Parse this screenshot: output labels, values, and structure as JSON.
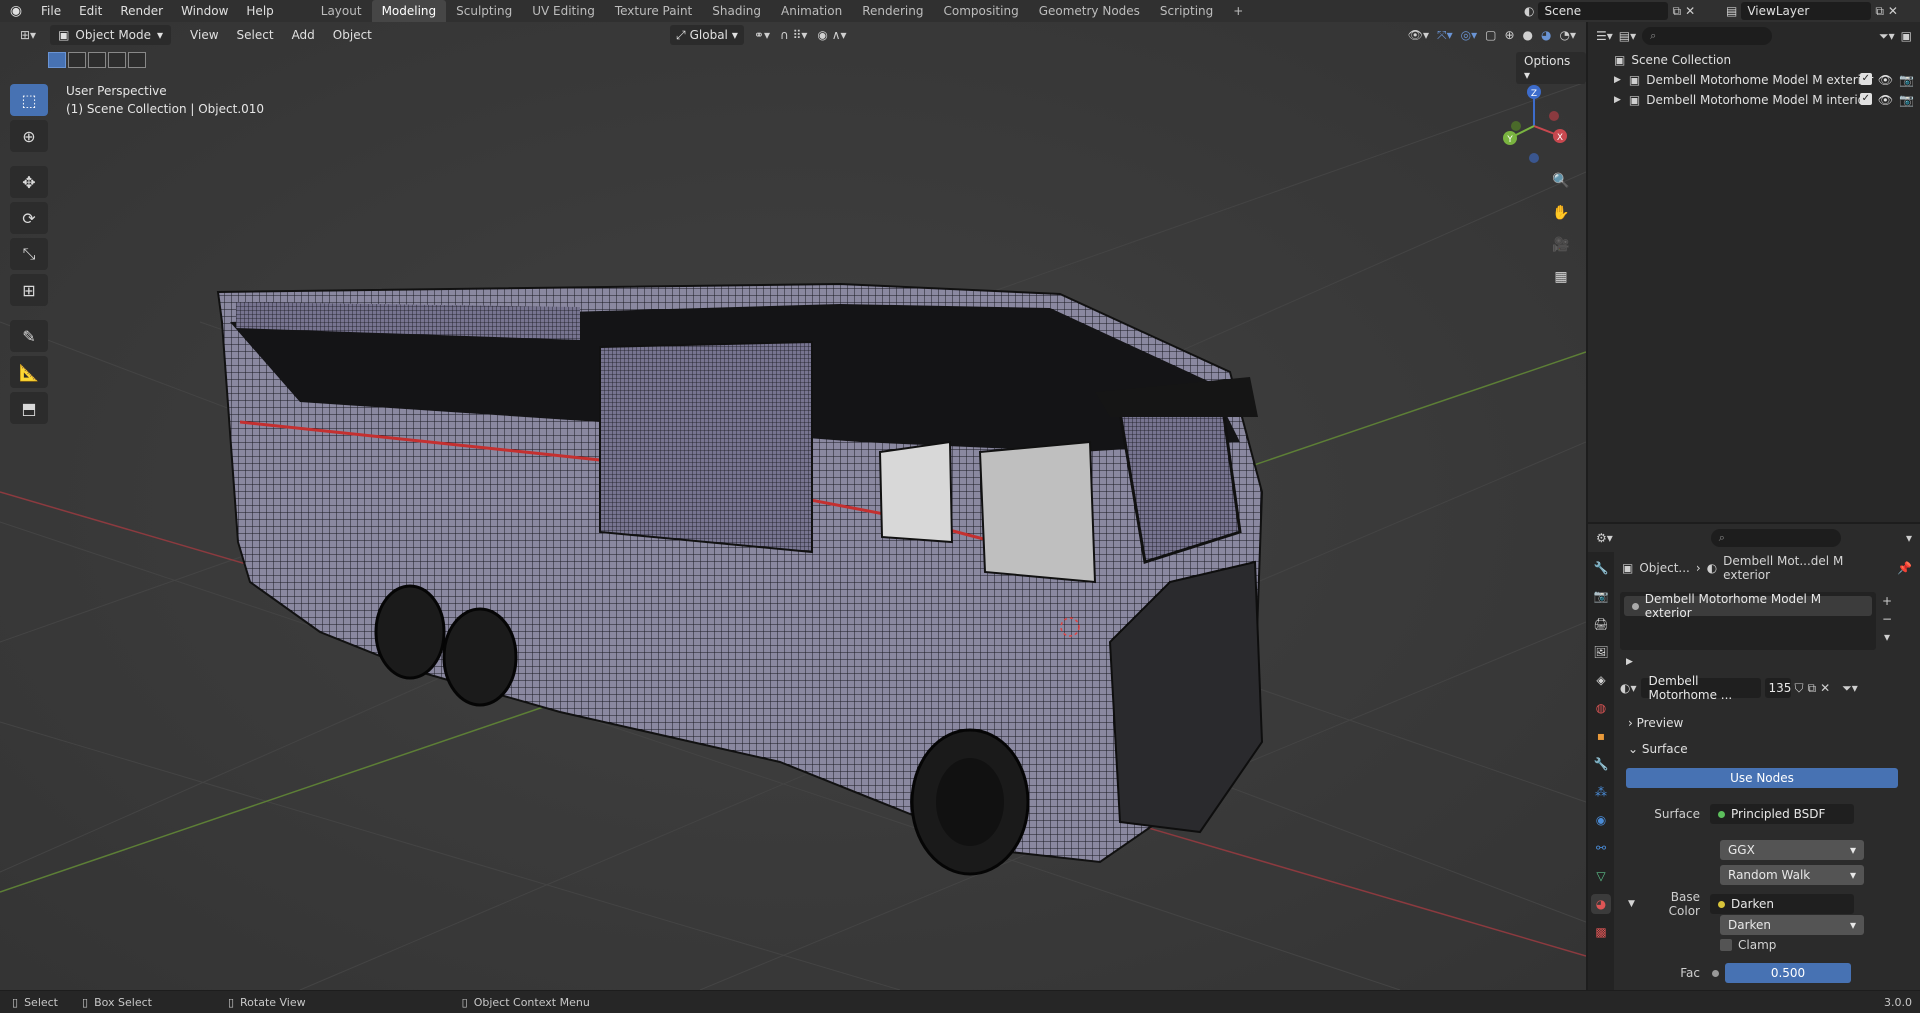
{
  "topbar": {
    "menu": [
      "File",
      "Edit",
      "Render",
      "Window",
      "Help"
    ],
    "workspaces": [
      "Layout",
      "Modeling",
      "Sculpting",
      "UV Editing",
      "Texture Paint",
      "Shading",
      "Animation",
      "Rendering",
      "Compositing",
      "Geometry Nodes",
      "Scripting"
    ],
    "active_workspace": "Modeling",
    "plus": "+",
    "scene": "Scene",
    "view_layer": "ViewLayer"
  },
  "viewport": {
    "mode": "Object Mode",
    "menu": [
      "View",
      "Select",
      "Add",
      "Object"
    ],
    "transform_orientation": "Global",
    "options_label": "Options",
    "overlay_line1": "User Perspective",
    "overlay_line2": "(1) Scene Collection | Object.010",
    "gizmo_axes": {
      "x": "X",
      "y": "Y",
      "z": "Z"
    }
  },
  "outliner": {
    "root": "Scene Collection",
    "items": [
      "Dembell Motorhome Model M exterior",
      "Dembell Motorhome Model M  interior"
    ]
  },
  "properties": {
    "breadcrumb_object": "Object...",
    "breadcrumb_material": "Dembell Mot...del M exterior",
    "slot_name": "Dembell Motorhome Model M exterior",
    "material_name": "Dembell Motorhome ...",
    "user_count": "135",
    "preview_label": "Preview",
    "surface_section": "Surface",
    "use_nodes_label": "Use Nodes",
    "surface_label": "Surface",
    "surface_value": "Principled BSDF",
    "distribution": "GGX",
    "subsurface_method": "Random Walk",
    "base_color_label": "Base Color",
    "base_color_value": "Darken",
    "blend_mode": "Darken",
    "clamp_label": "Clamp",
    "fac_label": "Fac",
    "fac_value": "0.500"
  },
  "statusbar": {
    "select": "Select",
    "box_select": "Box Select",
    "rotate_view": "Rotate View",
    "context_menu": "Object Context Menu",
    "version": "3.0.0"
  },
  "colors": {
    "accent": "#4772b3",
    "x_axis": "#c8484f",
    "y_axis": "#7ab440",
    "z_axis": "#3d6ccb"
  }
}
